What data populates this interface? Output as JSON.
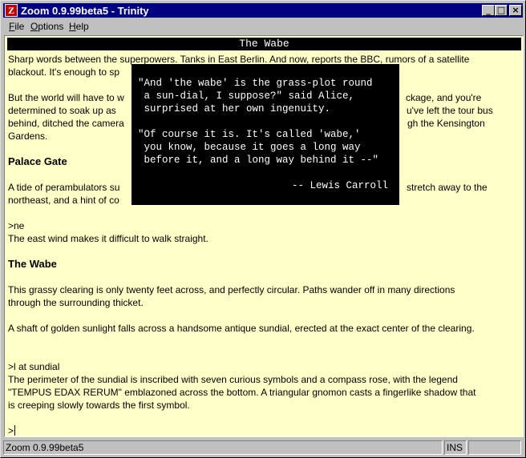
{
  "window": {
    "title": "Zoom 0.9.99beta5 - Trinity",
    "app_icon_glyph": "Z"
  },
  "controls": {
    "minimize": "_",
    "maximize": "□",
    "close": "×"
  },
  "menu": {
    "items": [
      {
        "key": "F",
        "rest": "ile"
      },
      {
        "key": "O",
        "rest": "ptions"
      },
      {
        "key": "H",
        "rest": "elp"
      }
    ]
  },
  "game": {
    "status_title": "The Wabe",
    "lines": [
      "Sharp words between the superpowers. Tanks in East Berlin. And now, reports the BBC, rumors of a satellite",
      "blackout. It's enough to sp",
      "But the world will have to w",
      "ckage, and you're",
      "determined to soak up as",
      "u've left the tour bus",
      "behind, ditched the camera",
      "gh the Kensington",
      "Gardens.",
      "Palace Gate",
      "A tide of perambulators su",
      "stretch away to the",
      "northeast, and a hint of co",
      ">ne",
      "The east wind makes it difficult to walk straight.",
      "The Wabe",
      "This grassy clearing is only twenty feet across, and perfectly circular. Paths wander off in many directions",
      "through the surrounding thicket.",
      "A shaft of golden sunlight falls across a handsome antique sundial, erected at the exact center of the clearing.",
      ">l at sundial",
      "The perimeter of the sundial is inscribed with seven curious symbols and a compass rose, with the legend",
      "\"TEMPUS EDAX RERUM\" emblazoned across the bottom. A triangular gnomon casts a fingerlike shadow that",
      "is creeping slowly towards the first symbol.",
      ">"
    ]
  },
  "quote": {
    "lines": [
      "\"And 'the wabe' is the grass-plot round",
      " a sun-dial, I suppose?\" said Alice,",
      " surprised at her own ingenuity.",
      "\"Of course it is. It's called 'wabe,'",
      " you know, because it goes a long way",
      " before it, and a long way behind it --\"",
      "-- Lewis Carroll"
    ]
  },
  "statusbar": {
    "text": "Zoom 0.9.99beta5",
    "mode": "INS"
  }
}
